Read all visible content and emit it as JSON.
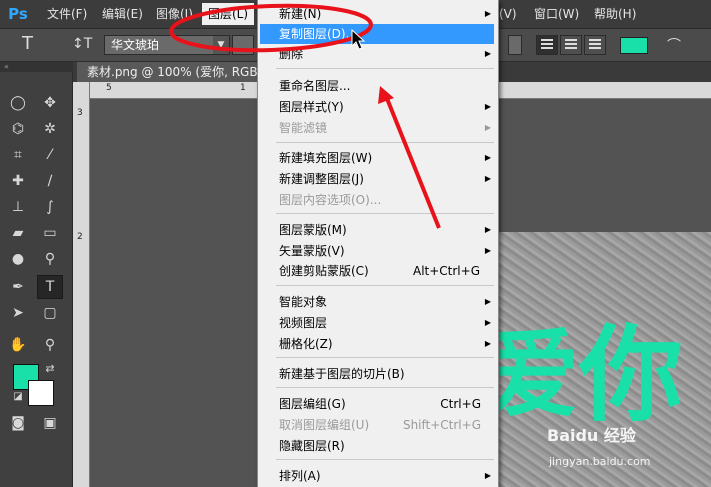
{
  "app": {
    "logo": "Ps"
  },
  "menubar": {
    "items": [
      {
        "label": "文件(F)"
      },
      {
        "label": "编辑(E)"
      },
      {
        "label": "图像(I)"
      },
      {
        "label": "图层(L)"
      },
      {
        "label": "(V)"
      },
      {
        "label": "窗口(W)"
      },
      {
        "label": "帮助(H)"
      }
    ]
  },
  "options": {
    "tool_glyph": "T",
    "orient_glyph": "↕T",
    "font_family": "华文琥珀",
    "text_color": "#19e0a8"
  },
  "document": {
    "tab_title": "素材.png @ 100% (爱你, RGB/8)"
  },
  "rulers": {
    "h": [
      "5",
      "1"
    ],
    "v": [
      "3",
      "2"
    ]
  },
  "canvas": {
    "glyph1": "爱",
    "glyph2": "你",
    "watermark": "Baidu 经验",
    "watermark_url": "jingyan.baidu.com"
  },
  "layer_menu": {
    "items": [
      {
        "label": "新建(N)",
        "submenu": true
      },
      {
        "label": "复制图层(D)...",
        "highlighted": true
      },
      {
        "label": "删除",
        "submenu": true
      },
      {
        "label": "重命名图层..."
      },
      {
        "label": "图层样式(Y)",
        "submenu": true
      },
      {
        "label": "智能滤镜",
        "disabled": true,
        "submenu": true
      },
      {
        "label": "新建填充图层(W)",
        "submenu": true
      },
      {
        "label": "新建调整图层(J)",
        "submenu": true
      },
      {
        "label": "图层内容选项(O)...",
        "disabled": true
      },
      {
        "label": "图层蒙版(M)",
        "submenu": true
      },
      {
        "label": "矢量蒙版(V)",
        "submenu": true
      },
      {
        "label": "创建剪贴蒙版(C)",
        "shortcut": "Alt+Ctrl+G"
      },
      {
        "label": "智能对象",
        "submenu": true
      },
      {
        "label": "视频图层",
        "submenu": true
      },
      {
        "label": "栅格化(Z)",
        "submenu": true
      },
      {
        "label": "新建基于图层的切片(B)"
      },
      {
        "label": "图层编组(G)",
        "shortcut": "Ctrl+G"
      },
      {
        "label": "取消图层编组(U)",
        "shortcut": "Shift+Ctrl+G",
        "disabled": true
      },
      {
        "label": "隐藏图层(R)"
      },
      {
        "label": "排列(A)",
        "submenu": true
      }
    ]
  },
  "colors": {
    "foreground": "#19e0a8",
    "background": "#ffffff",
    "annotation": "#e8121b",
    "menu_highlight": "#3399ff"
  }
}
